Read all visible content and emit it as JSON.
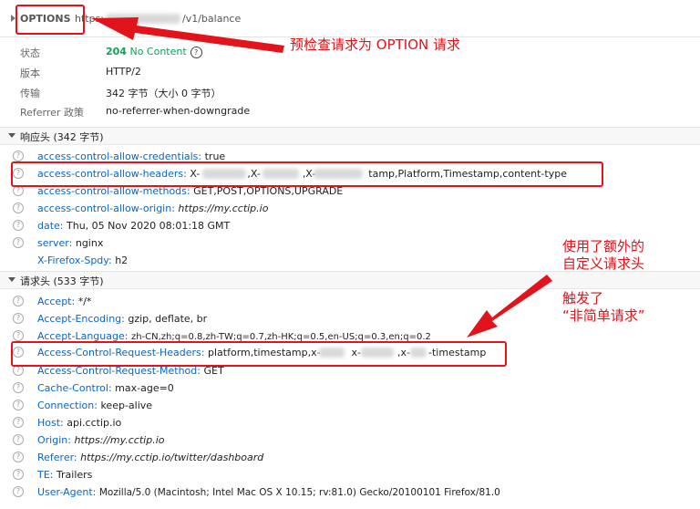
{
  "request": {
    "method": "OPTIONS",
    "url_prefix": "https:",
    "url_path": "/v1/balance"
  },
  "summary": [
    {
      "label": "状态",
      "code": "204",
      "text": "No Content"
    },
    {
      "label": "版本",
      "value": "HTTP/2"
    },
    {
      "label": "传输",
      "value": "342 字节（大小 0 字节）"
    },
    {
      "label": "Referrer 政策",
      "value": "no-referrer-when-downgrade"
    }
  ],
  "response_section": {
    "title": "响应头 (342 字节)",
    "headers": [
      {
        "name": "access-control-allow-credentials:",
        "value": "true"
      },
      {
        "name": "access-control-allow-headers:",
        "value_a": "X-",
        "value_b": ",X-",
        "value_c": ",X-",
        "value_d": "tamp,Platform,Timestamp,content-type"
      },
      {
        "name": "access-control-allow-methods:",
        "value": "GET,POST,OPTIONS,UPGRADE"
      },
      {
        "name": "access-control-allow-origin:",
        "value": "https://my.cctip.io"
      },
      {
        "name": "date:",
        "value": "Thu, 05 Nov 2020 08:01:18 GMT"
      },
      {
        "name": "server:",
        "value": "nginx"
      },
      {
        "name": "X-Firefox-Spdy:",
        "value": "h2"
      }
    ]
  },
  "request_section": {
    "title": "请求头 (533 字节)",
    "headers": [
      {
        "name": "Accept:",
        "value": "*/*"
      },
      {
        "name": "Accept-Encoding:",
        "value": "gzip, deflate, br"
      },
      {
        "name": "Accept-Language:",
        "value": "zh-CN,zh;q=0.8,zh-TW;q=0.7,zh-HK;q=0.5,en-US;q=0.3,en;q=0.2"
      },
      {
        "name": "Access-Control-Request-Headers:",
        "value_a": "platform,timestamp,x-",
        "value_b": "x-",
        "value_c": ",x-",
        "value_d": "-timestamp"
      },
      {
        "name": "Access-Control-Request-Method:",
        "value": "GET"
      },
      {
        "name": "Cache-Control:",
        "value": "max-age=0"
      },
      {
        "name": "Connection:",
        "value": "keep-alive"
      },
      {
        "name": "Host:",
        "value": "api.cctip.io"
      },
      {
        "name": "Origin:",
        "value": "https://my.cctip.io"
      },
      {
        "name": "Referer:",
        "value": "https://my.cctip.io/twitter/dashboard"
      },
      {
        "name": "TE:",
        "value": "Trailers"
      },
      {
        "name": "User-Agent:",
        "value": "Mozilla/5.0 (Macintosh; Intel Mac OS X 10.15; rv:81.0) Gecko/20100101 Firefox/81.0"
      }
    ]
  },
  "annotations": {
    "note1": "预检查请求为 OPTION 请求",
    "note2_line1": "使用了额外的",
    "note2_line2": "自定义请求头",
    "note3_line1": "触发了",
    "note3_line2": "“非简单请求”"
  },
  "colors": {
    "annotation": "#e2131a",
    "header_name": "#0b66c3",
    "status_ok": "#12a05b"
  }
}
